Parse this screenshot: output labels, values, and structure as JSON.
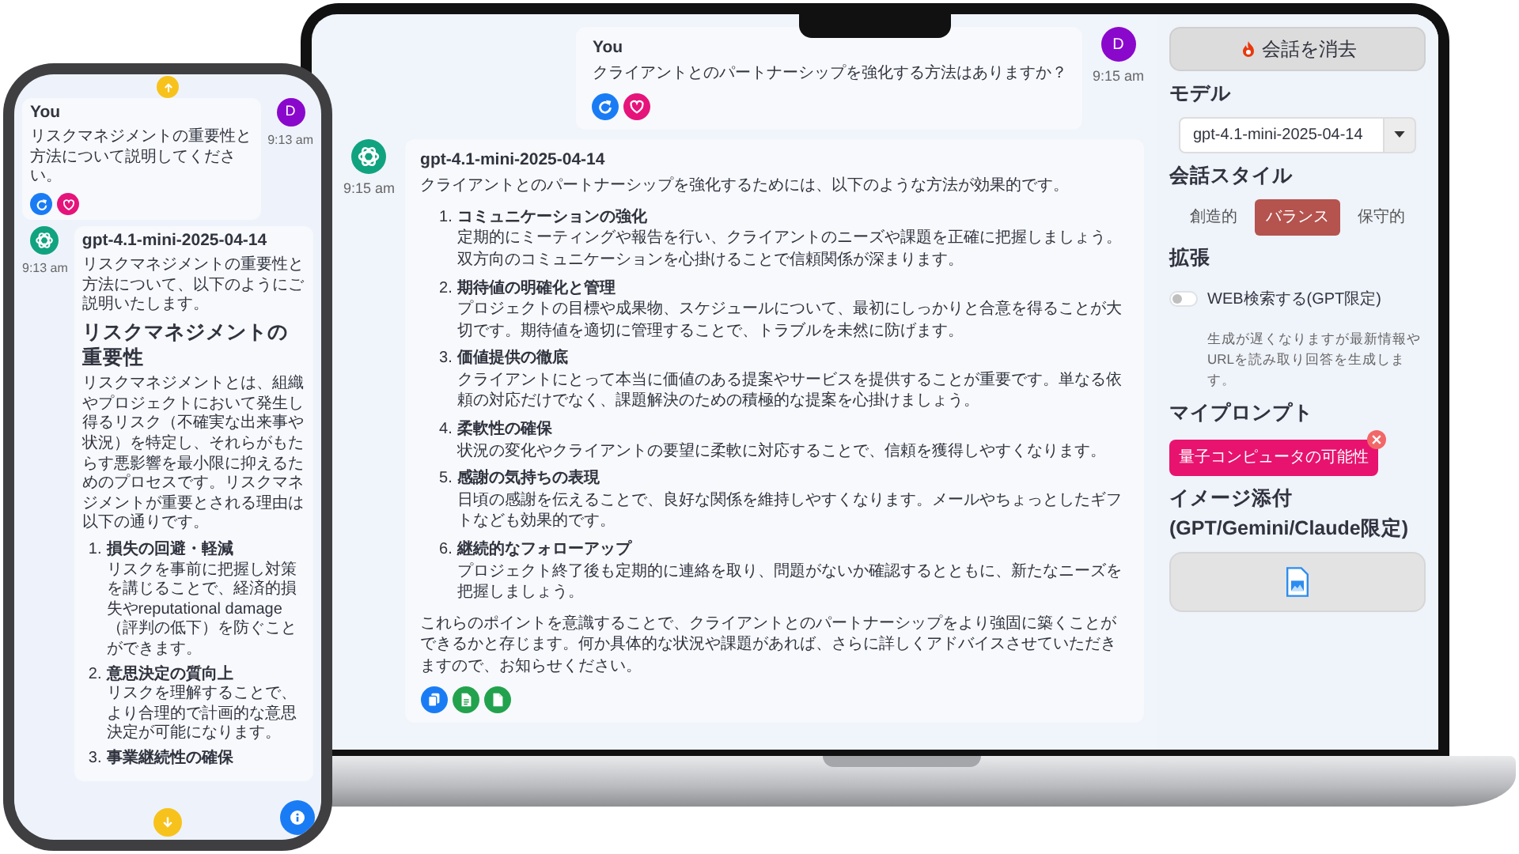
{
  "laptop": {
    "chat": {
      "messages": [
        {
          "kind": "user",
          "author": "You",
          "avatar": "D",
          "time": "9:15 am",
          "text": "クライアントとのパートナーシップを強化する方法はありますか？",
          "actions": [
            {
              "kind": "retry"
            },
            {
              "kind": "favorite"
            }
          ]
        },
        {
          "kind": "assistant",
          "author": "gpt-4.1-mini-2025-04-14",
          "time": "9:15 am",
          "blocks": [
            {
              "kind": "paragraph",
              "text": "クライアントとのパートナーシップを強化するためには、以下のような方法が効果的です。"
            },
            {
              "kind": "list",
              "items": [
                {
                  "number": "1.",
                  "title": "コミュニケーションの強化",
                  "body": "定期的にミーティングや報告を行い、クライアントのニーズや課題を正確に把握しましょう。双方向のコミュニケーションを心掛けることで信頼関係が深まります。"
                },
                {
                  "number": "2.",
                  "title": "期待値の明確化と管理",
                  "body": "プロジェクトの目標や成果物、スケジュールについて、最初にしっかりと合意を得ることが大切です。期待値を適切に管理することで、トラブルを未然に防げます。"
                },
                {
                  "number": "3.",
                  "title": "価値提供の徹底",
                  "body": "クライアントにとって本当に価値のある提案やサービスを提供することが重要です。単なる依頼の対応だけでなく、課題解決のための積極的な提案を心掛けましょう。"
                },
                {
                  "number": "4.",
                  "title": "柔軟性の確保",
                  "body": "状況の変化やクライアントの要望に柔軟に対応することで、信頼を獲得しやすくなります。"
                },
                {
                  "number": "5.",
                  "title": "感謝の気持ちの表現",
                  "body": "日頃の感謝を伝えることで、良好な関係を維持しやすくなります。メールやちょっとしたギフトなども効果的です。"
                },
                {
                  "number": "6.",
                  "title": "継続的なフォローアップ",
                  "body": "プロジェクト終了後も定期的に連絡を取り、問題がないか確認するとともに、新たなニーズを把握しましょう。"
                }
              ]
            },
            {
              "kind": "paragraph",
              "text": "これらのポイントを意識することで、クライアントとのパートナーシップをより強固に築くことができるかと存じます。何か具体的な状況や課題があれば、さらに詳しくアドバイスさせていただきますので、お知らせください。"
            }
          ],
          "actions": [
            {
              "kind": "copy"
            },
            {
              "kind": "text-file"
            },
            {
              "kind": "file"
            }
          ]
        }
      ]
    },
    "sidebar": {
      "clear_button": "会話を消去",
      "model_label": "モデル",
      "model_value": "gpt-4.1-mini-2025-04-14",
      "style_label": "会話スタイル",
      "styles": [
        {
          "label": "創造的",
          "selected": false
        },
        {
          "label": "バランス",
          "selected": true
        },
        {
          "label": "保守的",
          "selected": false
        }
      ],
      "extension_label": "拡張",
      "web_search": {
        "label": "WEB検索する(GPT限定)",
        "on": false,
        "hint": "生成が遅くなりますが最新情報やURLを読み取り回答を生成します。"
      },
      "prompt_label": "マイプロンプト",
      "prompts": [
        "量子コンピュータの可能性"
      ],
      "image_label": "イメージ添付 (GPT/Gemini/Claude限定)"
    }
  },
  "phone": {
    "chat": {
      "messages": [
        {
          "kind": "user",
          "author": "You",
          "avatar": "D",
          "time": "9:13 am",
          "text": "リスクマネジメントの重要性と方法について説明してください。",
          "actions": [
            {
              "kind": "retry"
            },
            {
              "kind": "favorite"
            }
          ]
        },
        {
          "kind": "assistant",
          "author": "gpt-4.1-mini-2025-04-14",
          "time": "9:13 am",
          "blocks": [
            {
              "kind": "paragraph",
              "text": "リスクマネジメントの重要性と方法について、以下のようにご説明いたします。"
            },
            {
              "kind": "heading",
              "text": "リスクマネジメントの重要性"
            },
            {
              "kind": "paragraph",
              "text": "リスクマネジメントとは、組織やプロジェクトにおいて発生し得るリスク（不確実な出来事や状況）を特定し、それらがもたらす悪影響を最小限に抑えるためのプロセスです。リスクマネジメントが重要とされる理由は以下の通りです。"
            },
            {
              "kind": "list",
              "items": [
                {
                  "number": "1.",
                  "title": "損失の回避・軽減",
                  "body": "リスクを事前に把握し対策を講じることで、経済的損失やreputational damage（評判の低下）を防ぐことができます。"
                },
                {
                  "number": "2.",
                  "title": "意思決定の質向上",
                  "body": "リスクを理解することで、より合理的で計画的な意思決定が可能になります。"
                },
                {
                  "number": "3.",
                  "title": "事業継続性の確保"
                }
              ]
            }
          ]
        }
      ]
    }
  }
}
